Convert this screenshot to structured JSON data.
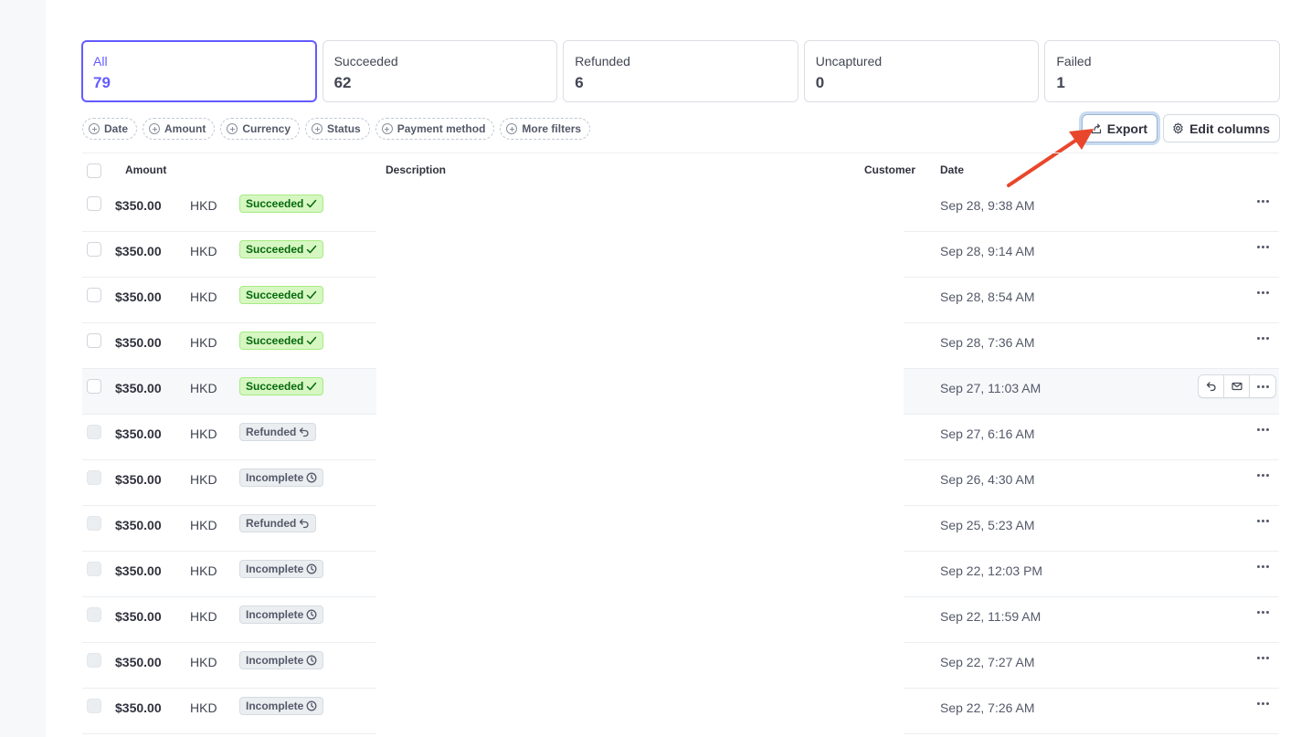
{
  "tabs": [
    {
      "label": "All",
      "count": "79",
      "active": true
    },
    {
      "label": "Succeeded",
      "count": "62"
    },
    {
      "label": "Refunded",
      "count": "6"
    },
    {
      "label": "Uncaptured",
      "count": "0"
    },
    {
      "label": "Failed",
      "count": "1"
    }
  ],
  "filters": [
    "Date",
    "Amount",
    "Currency",
    "Status",
    "Payment method",
    "More filters"
  ],
  "toolbar": {
    "export_label": "Export",
    "edit_columns_label": "Edit columns"
  },
  "columns": {
    "amount": "Amount",
    "description": "Description",
    "customer": "Customer",
    "date": "Date"
  },
  "rows": [
    {
      "amount": "$350.00",
      "currency": "HKD",
      "status": "Succeeded",
      "date": "Sep 28, 9:38 AM"
    },
    {
      "amount": "$350.00",
      "currency": "HKD",
      "status": "Succeeded",
      "date": "Sep 28, 9:14 AM"
    },
    {
      "amount": "$350.00",
      "currency": "HKD",
      "status": "Succeeded",
      "date": "Sep 28, 8:54 AM"
    },
    {
      "amount": "$350.00",
      "currency": "HKD",
      "status": "Succeeded",
      "date": "Sep 28, 7:36 AM"
    },
    {
      "amount": "$350.00",
      "currency": "HKD",
      "status": "Succeeded",
      "date": "Sep 27, 11:03 AM"
    },
    {
      "amount": "$350.00",
      "currency": "HKD",
      "status": "Refunded",
      "date": "Sep 27, 6:16 AM"
    },
    {
      "amount": "$350.00",
      "currency": "HKD",
      "status": "Incomplete",
      "date": "Sep 26, 4:30 AM"
    },
    {
      "amount": "$350.00",
      "currency": "HKD",
      "status": "Refunded",
      "date": "Sep 25, 5:23 AM"
    },
    {
      "amount": "$350.00",
      "currency": "HKD",
      "status": "Incomplete",
      "date": "Sep 22, 12:03 PM"
    },
    {
      "amount": "$350.00",
      "currency": "HKD",
      "status": "Incomplete",
      "date": "Sep 22, 11:59 AM"
    },
    {
      "amount": "$350.00",
      "currency": "HKD",
      "status": "Incomplete",
      "date": "Sep 22, 7:27 AM"
    },
    {
      "amount": "$350.00",
      "currency": "HKD",
      "status": "Incomplete",
      "date": "Sep 22, 7:26 AM"
    }
  ],
  "hovered_row": 4,
  "colors": {
    "accent": "#635bff",
    "success_bg": "#d7f7c2",
    "success_text": "#05690d",
    "annotation_arrow": "#e8472c"
  },
  "icons": {
    "filter": "plus-circle-icon",
    "export": "export-icon",
    "edit_columns": "gear-icon",
    "succeeded": "check-icon",
    "refunded": "refund-arrow-icon",
    "incomplete": "clock-icon",
    "row_menu": "more-horizontal-icon",
    "refund_action": "refund-action-icon",
    "email_action": "mail-icon"
  }
}
